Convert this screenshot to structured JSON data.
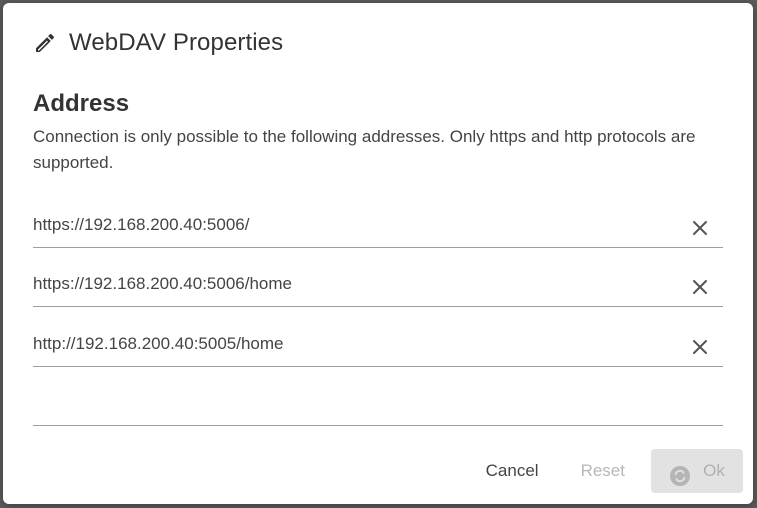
{
  "dialog": {
    "title": "WebDAV Properties",
    "title_icon": "pencil-icon"
  },
  "address_section": {
    "heading": "Address",
    "description": "Connection is only possible to the following addresses. Only https and http protocols are supported.",
    "addresses": [
      "https://192.168.200.40:5006/",
      "https://192.168.200.40:5006/home",
      "http://192.168.200.40:5005/home"
    ],
    "new_address_value": ""
  },
  "buttons": {
    "cancel": "Cancel",
    "reset": "Reset",
    "ok": "Ok"
  },
  "colors": {
    "text": "#333333",
    "disabled": "#b8b8b8",
    "ok_background": "#e2e2e2",
    "underline": "#9e9e9e"
  }
}
